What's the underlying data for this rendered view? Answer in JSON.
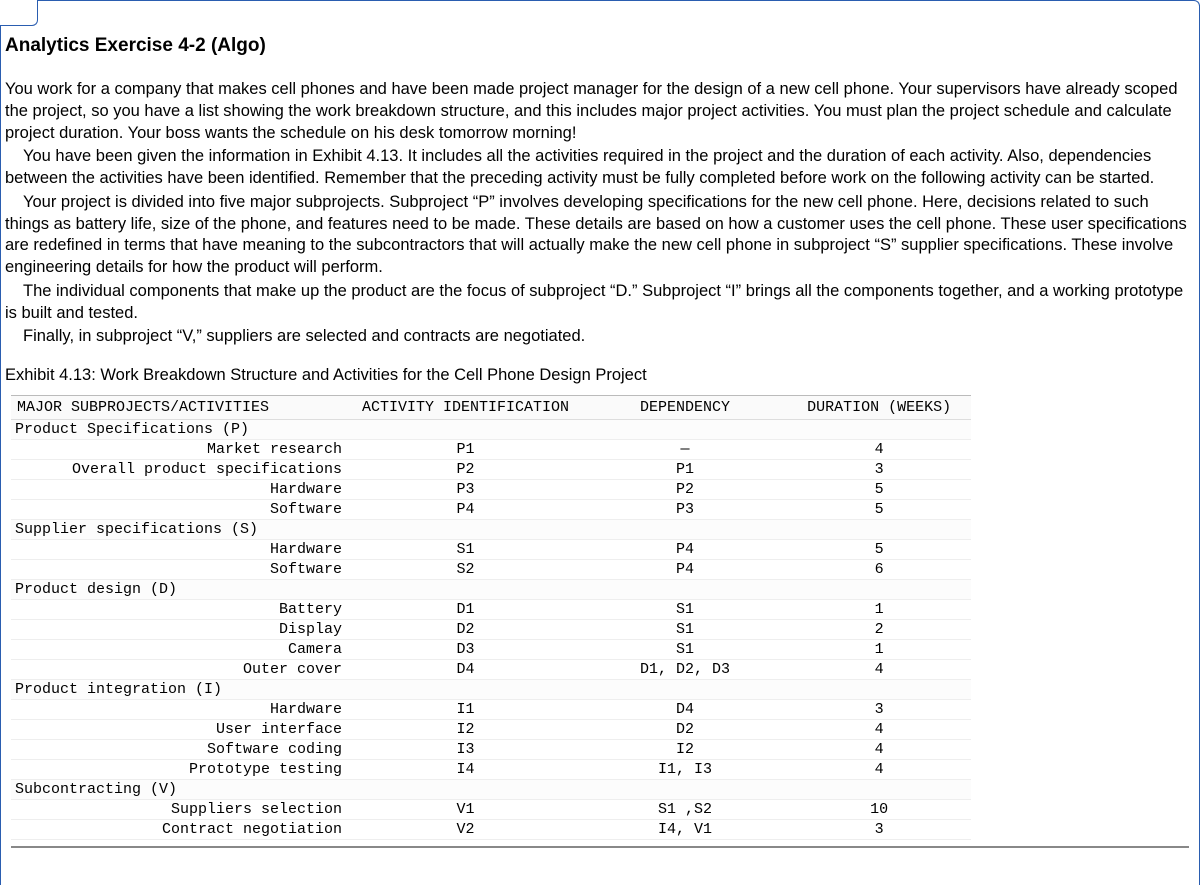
{
  "title": "Analytics Exercise 4-2 (Algo)",
  "paragraphs": {
    "p1": "You work for a company that makes cell phones and have been made project manager for the design of a new cell phone. Your supervisors have already scoped the project, so you have a list showing the work breakdown structure, and this includes major project activities. You must plan the project schedule and calculate project duration. Your boss wants the schedule on his desk tomorrow morning!",
    "p2": "You have been given the information in Exhibit 4.13. It includes all the activities required in the project and the duration of each activity. Also, dependencies between the activities have been identified. Remember that the preceding activity must be fully completed before work on the following activity can be started.",
    "p3": "Your project is divided into five major subprojects. Subproject “P” involves developing specifications for the new cell phone. Here, decisions related to such things as battery life, size of the phone, and features need to be made. These details are based on how a customer uses the cell phone. These user specifications are redefined in terms that have meaning to the subcontractors that will actually make the new cell phone in subproject “S” supplier specifications. These involve engineering details for how the product will perform.",
    "p4": "The individual components that make up the product are the focus of subproject “D.” Subproject “I” brings all the components together, and a working prototype is built and tested.",
    "p5": "Finally, in subproject “V,” suppliers are selected and contracts are negotiated."
  },
  "exhibit_caption": "Exhibit 4.13: Work Breakdown Structure and Activities for the Cell Phone Design Project",
  "columns": {
    "c1": "MAJOR SUBPROJECTS/ACTIVITIES",
    "c2": "ACTIVITY IDENTIFICATION",
    "c3": "DEPENDENCY",
    "c4": "DURATION (WEEKS)"
  },
  "groups": [
    {
      "label": "Product Specifications (P)",
      "rows": [
        {
          "activity": "Market research",
          "id": "P1",
          "dep": "—",
          "dur": "4"
        },
        {
          "activity": "Overall product specifications",
          "id": "P2",
          "dep": "P1",
          "dur": "3"
        },
        {
          "activity": "Hardware",
          "id": "P3",
          "dep": "P2",
          "dur": "5"
        },
        {
          "activity": "Software",
          "id": "P4",
          "dep": "P3",
          "dur": "5"
        }
      ]
    },
    {
      "label": "Supplier specifications (S)",
      "rows": [
        {
          "activity": "Hardware",
          "id": "S1",
          "dep": "P4",
          "dur": "5"
        },
        {
          "activity": "Software",
          "id": "S2",
          "dep": "P4",
          "dur": "6"
        }
      ]
    },
    {
      "label": "Product design (D)",
      "rows": [
        {
          "activity": "Battery",
          "id": "D1",
          "dep": "S1",
          "dur": "1"
        },
        {
          "activity": "Display",
          "id": "D2",
          "dep": "S1",
          "dur": "2"
        },
        {
          "activity": "Camera",
          "id": "D3",
          "dep": "S1",
          "dur": "1"
        },
        {
          "activity": "Outer cover",
          "id": "D4",
          "dep": "D1, D2, D3",
          "dur": "4"
        }
      ]
    },
    {
      "label": "Product integration (I)",
      "rows": [
        {
          "activity": "Hardware",
          "id": "I1",
          "dep": "D4",
          "dur": "3"
        },
        {
          "activity": "User interface",
          "id": "I2",
          "dep": "D2",
          "dur": "4"
        },
        {
          "activity": "Software coding",
          "id": "I3",
          "dep": "I2",
          "dur": "4"
        },
        {
          "activity": "Prototype testing",
          "id": "I4",
          "dep": "I1, I3",
          "dur": "4"
        }
      ]
    },
    {
      "label": "Subcontracting (V)",
      "rows": [
        {
          "activity": "Suppliers selection",
          "id": "V1",
          "dep": "S1 ,S2",
          "dur": "10"
        },
        {
          "activity": "Contract negotiation",
          "id": "V2",
          "dep": "I4, V1",
          "dur": "3"
        }
      ]
    }
  ]
}
